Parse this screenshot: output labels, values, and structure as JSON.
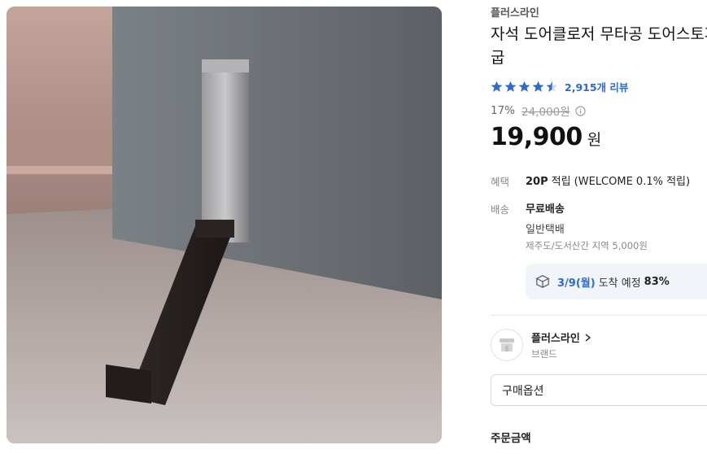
{
  "product": {
    "brand": "플러스라인",
    "title": "자석 도어클로저 무타공 도어스토퍼 말발굽",
    "rating": 4.5,
    "review_count": "2,915개 리뷰",
    "discount": "17%",
    "original_price": "24,000원",
    "price": "19,900",
    "price_unit": "원",
    "image_alt": "도어스토퍼 제품 이미지"
  },
  "benefit": {
    "label": "혜택",
    "points": "20P",
    "text": "적립 (WELCOME 0.1% 적립)"
  },
  "shipping": {
    "label": "배송",
    "free": "무료배송",
    "type": "일반택배",
    "extra": "제주도/도서산간 지역 5,000원",
    "arrival_date": "3/9(월)",
    "arrival_text": "도착 예정",
    "arrival_pct": "83%"
  },
  "seller": {
    "name": "플러스라인",
    "sub": "브랜드"
  },
  "purchase": {
    "option_label": "구매옵션",
    "order_total_label": "주문금액"
  },
  "colors": {
    "star": "#2d6bd0",
    "accent": "#2d6bd0"
  },
  "icons": {
    "star": "star-icon",
    "info": "info-icon",
    "delivery": "box-icon",
    "store": "store-icon",
    "chevron": "chevron-right-icon"
  }
}
